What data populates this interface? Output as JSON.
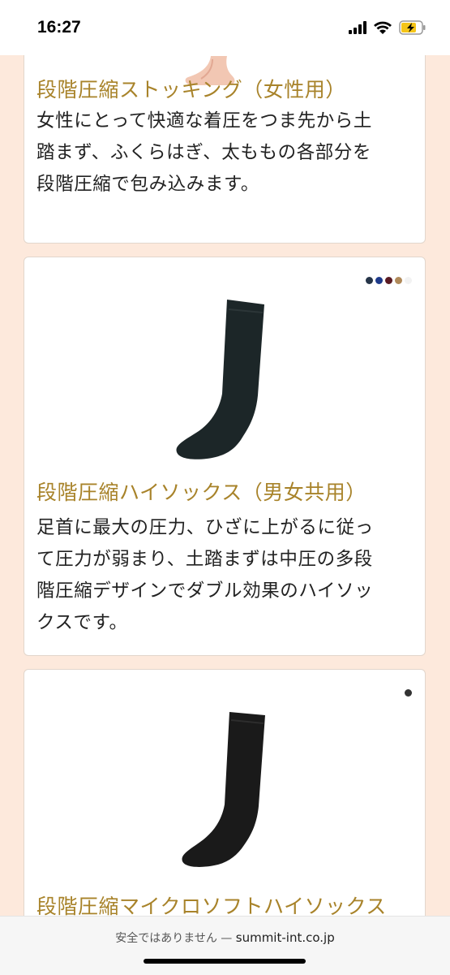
{
  "status_bar": {
    "time": "16:27",
    "icons": [
      "signal-icon",
      "wifi-icon",
      "battery-charging-icon"
    ]
  },
  "products": [
    {
      "title": "段階圧縮ストッキング（女性用）",
      "description": [
        "女性にとって快適な着圧をつま先から土",
        "踏まず、ふくらはぎ、太ももの各部分を",
        "段階圧縮で包み込みます。"
      ],
      "image": "foot-image"
    },
    {
      "title": "段階圧縮ハイソックス（男女共用）",
      "description": [
        "足首に最大の圧力、ひざに上がるに従っ",
        "て圧力が弱まり、土踏まずは中圧の多段",
        "階圧縮デザインでダブル効果のハイソッ",
        "クスです。"
      ],
      "color_swatches": [
        "#263548",
        "#1e3a8a",
        "#5a1a22",
        "#b08a5a",
        "#f2f2f2"
      ],
      "image": "sock-image"
    },
    {
      "title": "段階圧縮マイクロソフトハイソックス",
      "color_swatches": [
        "#333333"
      ],
      "image": "sock-image"
    }
  ],
  "url_bar": {
    "security_text": "安全ではありません —",
    "domain": "summit-int.co.jp"
  }
}
